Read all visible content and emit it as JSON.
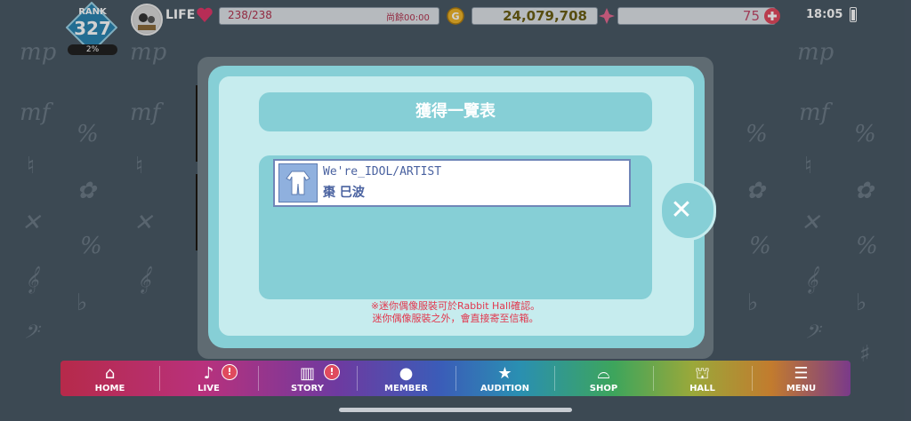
{
  "status": {
    "rank_label": "RANK",
    "rank_value": "327",
    "rank_progress": "2%",
    "life_label": "LIFE",
    "life_value": "238/238",
    "remaining_label": "尚餘00:00",
    "coin_value": "24,079,708",
    "gem_value": "75",
    "time": "18:05"
  },
  "dialog": {
    "title": "獲得一覽表",
    "items": [
      {
        "name": "We're_IDOL/ARTIST",
        "owner": "棗 巳波",
        "icon": "costume-icon"
      }
    ],
    "note_line1": "※迷你偶像服裝可於Rabbit Hall確認。",
    "note_line2": "迷你偶像服裝之外，會直接寄至信箱。",
    "close_icon": "close-icon"
  },
  "nav": {
    "home": "HOME",
    "live": "LIVE",
    "story": "STORY",
    "member": "MEMBER",
    "audition": "AUDITION",
    "shop": "SHOP",
    "hall": "HALL",
    "menu": "MENU",
    "badge": "!"
  },
  "background_symbols": [
    "mp",
    "mf",
    "%",
    "♮",
    "✿",
    "✕",
    "𝄞",
    "♭",
    "𝄢",
    "♯"
  ],
  "colors": {
    "dialog_accent": "#86cfd6",
    "dialog_inner": "#c6ecee",
    "note_red": "#e2374d",
    "item_text": "#4a62a0"
  }
}
